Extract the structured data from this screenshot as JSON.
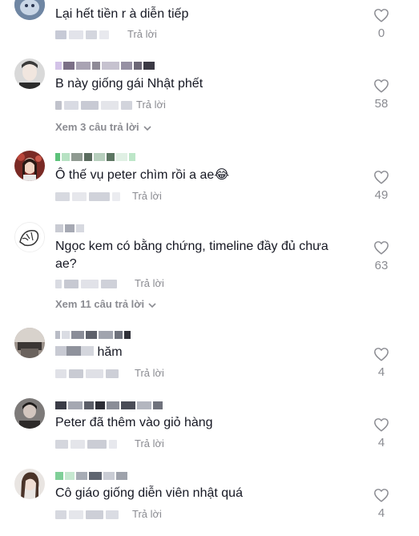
{
  "comments": [
    {
      "text": "Lại hết tiền r à diễn tiếp",
      "reply_label": "Trả lời",
      "likes": "0"
    },
    {
      "text": "B này giống gái Nhật phết",
      "reply_label": "Trả lời",
      "likes": "58",
      "view_replies": "Xem 3 câu trả lời"
    },
    {
      "text": "Ô thế vụ peter chìm rồi a ae😂",
      "reply_label": "Trả lời",
      "likes": "49"
    },
    {
      "text": "Ngọc kem có bằng chứng, timeline đầy đủ chưa ae?",
      "reply_label": "Trả lời",
      "likes": "63",
      "view_replies": "Xem 11 câu trả lời"
    },
    {
      "text": "hăm",
      "reply_label": "Trả lời",
      "likes": "4"
    },
    {
      "text": "Peter đã thêm vào giỏ hàng",
      "reply_label": "Trả lời",
      "likes": "4"
    },
    {
      "text": "Cô giáo giống diễn viên nhật quá",
      "reply_label": "Trả lời",
      "likes": "4"
    }
  ],
  "icons": {
    "like": "heart-outline-icon",
    "expand": "chevron-down-icon"
  },
  "colors": {
    "text": "#161823",
    "muted": "#8a8b91",
    "background": "#ffffff"
  }
}
